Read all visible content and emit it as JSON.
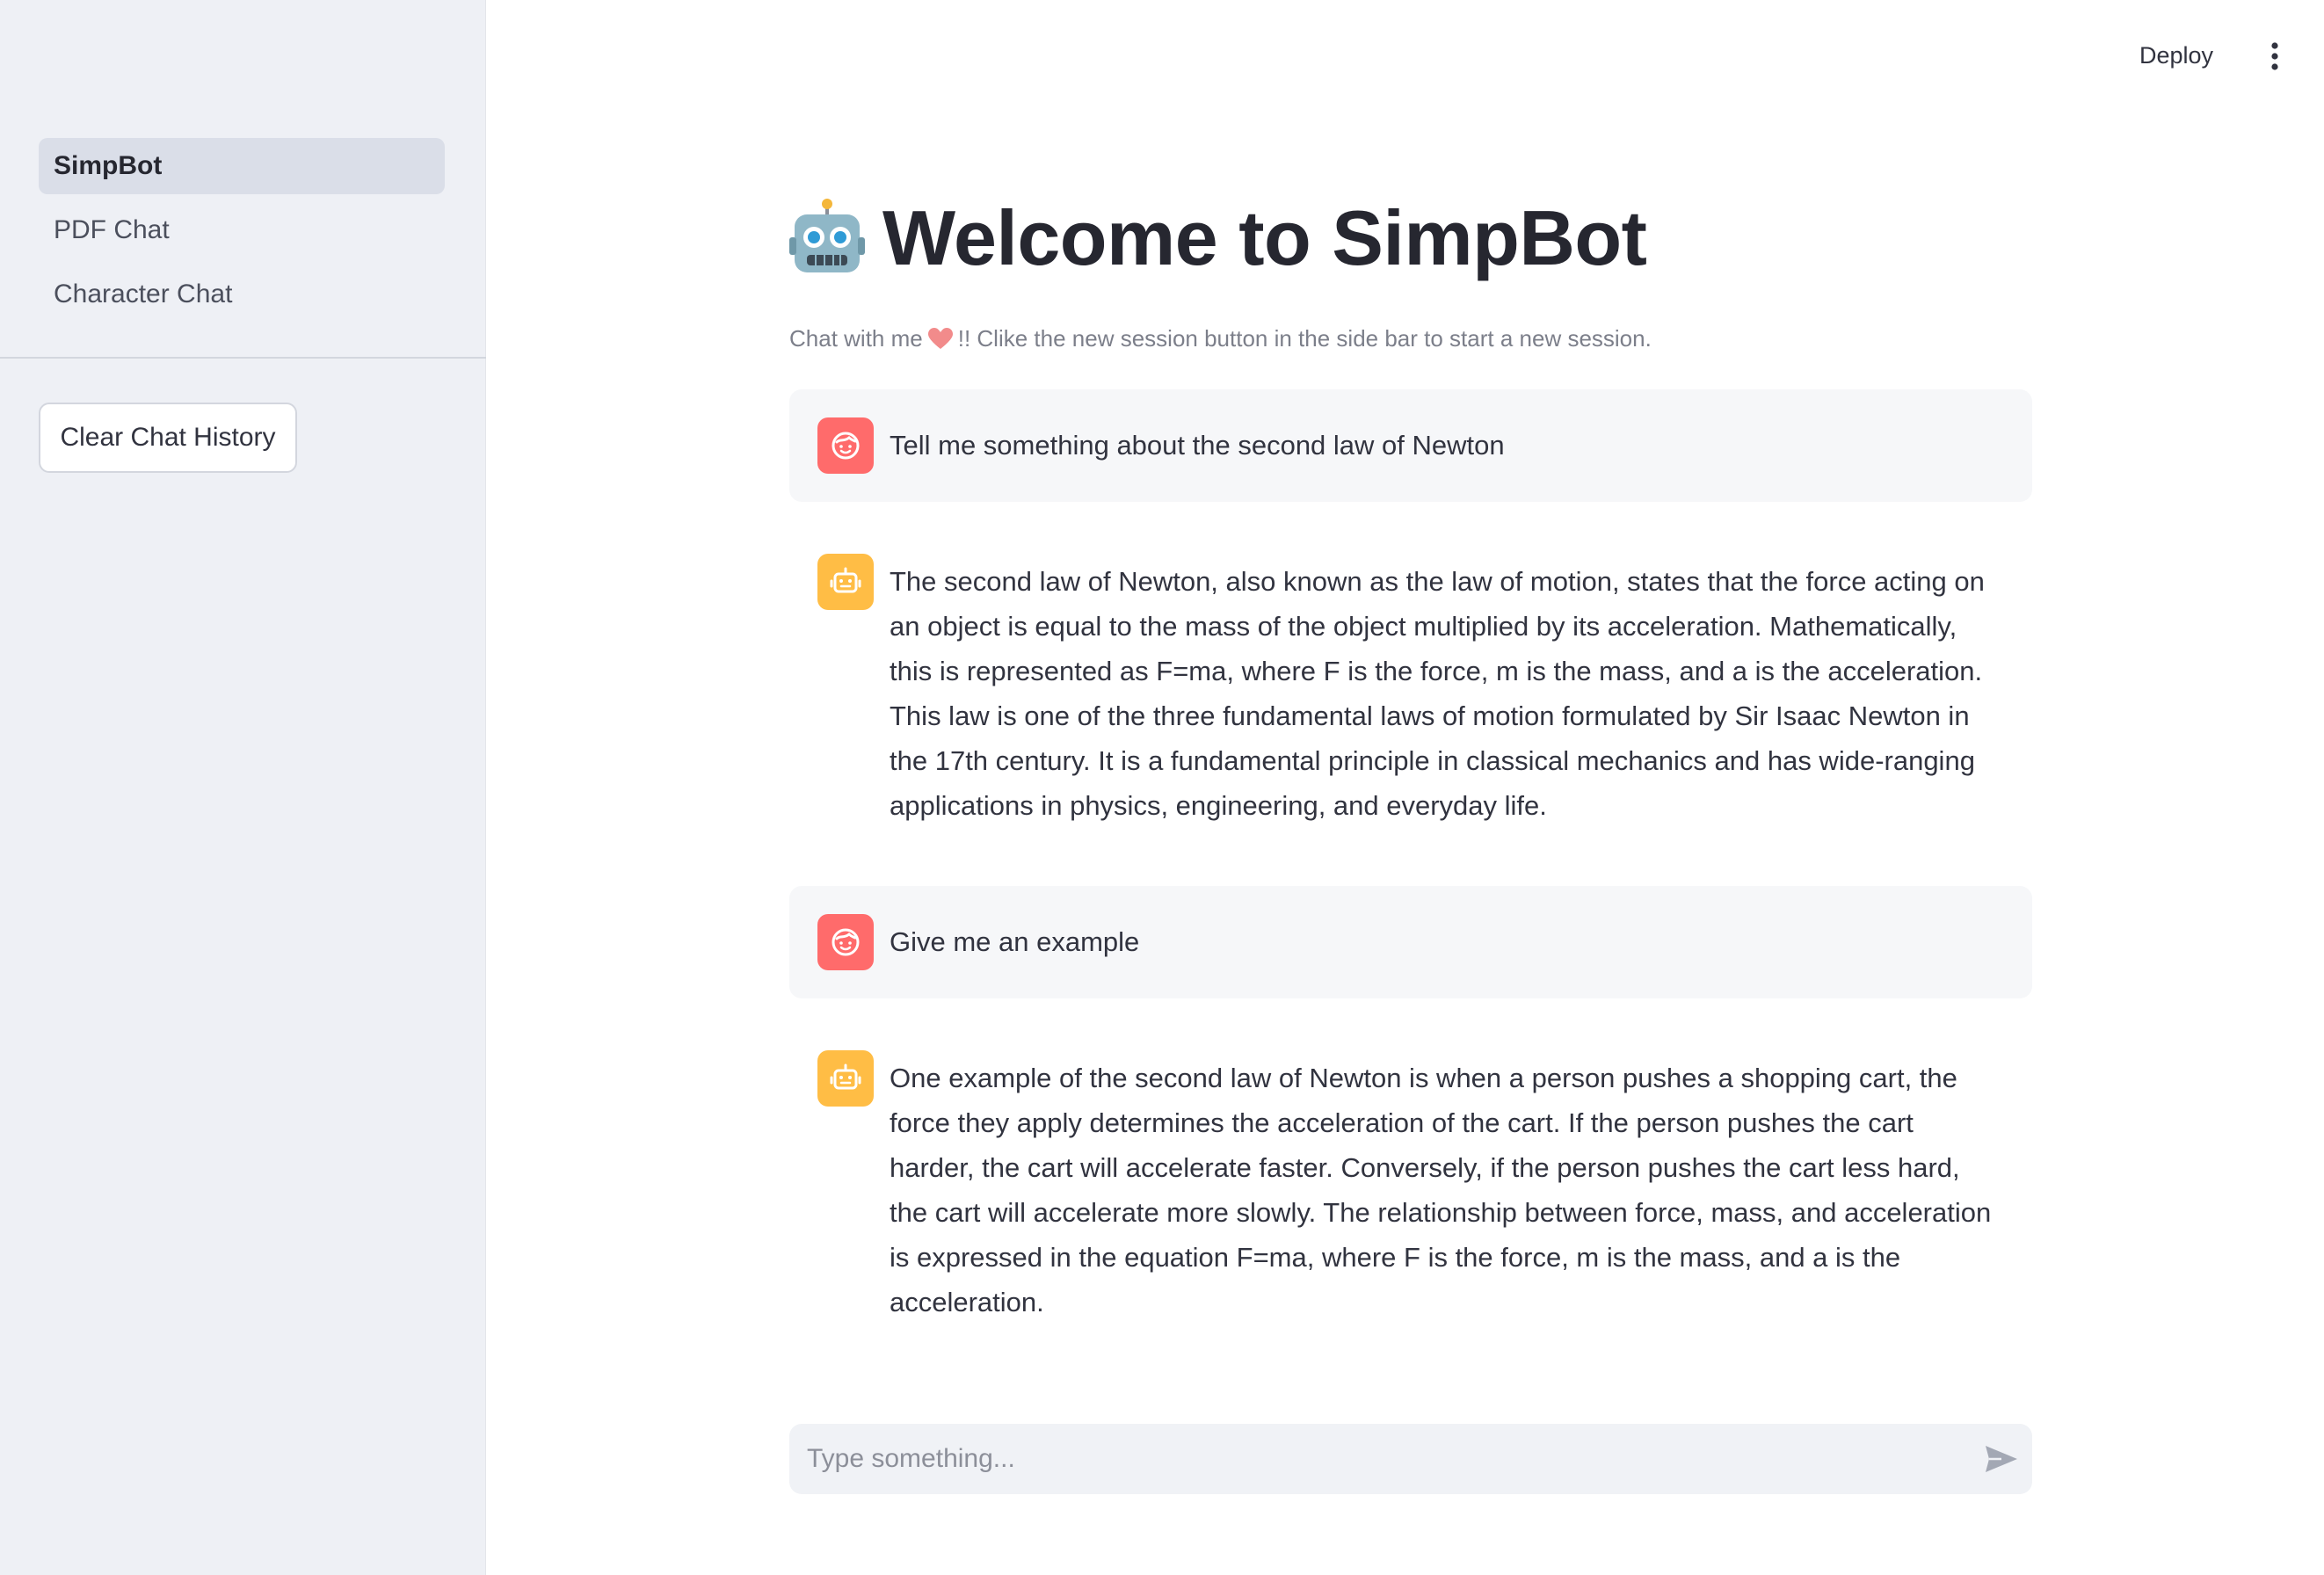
{
  "sidebar": {
    "items": [
      {
        "label": "SimpBot",
        "active": true
      },
      {
        "label": "PDF Chat",
        "active": false
      },
      {
        "label": "Character Chat",
        "active": false
      }
    ],
    "clear_button": "Clear Chat History"
  },
  "topbar": {
    "deploy_label": "Deploy",
    "menu_icon": "kebab-menu-icon"
  },
  "main": {
    "title_icon": "robot-emoji-icon",
    "title": "Welcome to SimpBot",
    "subtitle_before": "Chat with me",
    "subtitle_icon": "heart-emoji-icon",
    "subtitle_after": "!! Clike the new session button in the side bar to start a new session."
  },
  "messages": [
    {
      "role": "user",
      "text": "Tell me something about the second law of Newton"
    },
    {
      "role": "assistant",
      "text": "The second law of Newton, also known as the law of motion, states that the force acting on an object is equal to the mass of the object multiplied by its acceleration. Mathematically, this is represented as F=ma, where F is the force, m is the mass, and a is the acceleration. This law is one of the three fundamental laws of motion formulated by Sir Isaac Newton in the 17th century. It is a fundamental principle in classical mechanics and has wide-ranging applications in physics, engineering, and everyday life."
    },
    {
      "role": "user",
      "text": "Give me an example"
    },
    {
      "role": "assistant",
      "text": "One example of the second law of Newton is when a person pushes a shopping cart, the force they apply determines the acceleration of the cart. If the person pushes the cart harder, the cart will accelerate faster. Conversely, if the person pushes the cart less hard, the cart will accelerate more slowly. The relationship between force, mass, and acceleration is expressed in the equation F=ma, where F is the force, m is the mass, and a is the acceleration."
    }
  ],
  "chat_input": {
    "placeholder": "Type something...",
    "send_icon": "send-icon"
  },
  "colors": {
    "sidebar_bg": "#eef0f5",
    "user_avatar": "#ff6b6b",
    "assistant_avatar": "#ffbd45",
    "user_msg_bg": "#f6f7f9"
  }
}
